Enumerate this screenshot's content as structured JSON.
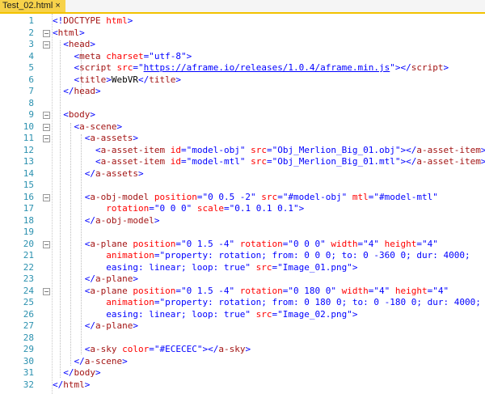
{
  "tab": {
    "title": "Test_02.html",
    "close_glyph": "×"
  },
  "fold_glyph": "⊟",
  "colors": {
    "bracket": "#0000ff",
    "tag": "#a31515",
    "attr": "#ff0000",
    "value": "#0000ff",
    "text": "#000000",
    "line_number": "#2b91af",
    "tab_accent": "#f2c200"
  },
  "lines": [
    {
      "n": "1",
      "tokens": [
        [
          "b",
          "<!"
        ],
        [
          "g",
          "DOCTYPE"
        ],
        [
          "a",
          " html"
        ],
        [
          "b",
          ">"
        ]
      ]
    },
    {
      "n": "2",
      "fold": true,
      "tokens": [
        [
          "b",
          "<"
        ],
        [
          "g",
          "html"
        ],
        [
          "b",
          ">"
        ]
      ]
    },
    {
      "n": "3",
      "fold": true,
      "tokens": [
        [
          "b",
          "  <"
        ],
        [
          "g",
          "head"
        ],
        [
          "b",
          ">"
        ]
      ]
    },
    {
      "n": "4",
      "tokens": [
        [
          "b",
          "    <"
        ],
        [
          "g",
          "meta"
        ],
        [
          "a",
          " charset"
        ],
        [
          "b",
          "="
        ],
        [
          "v",
          "\"utf-8\""
        ],
        [
          "b",
          ">"
        ]
      ]
    },
    {
      "n": "5",
      "tokens": [
        [
          "b",
          "    <"
        ],
        [
          "g",
          "script"
        ],
        [
          "a",
          " src"
        ],
        [
          "b",
          "=\""
        ],
        [
          "l",
          "https://aframe.io/releases/1.0.4/aframe.min.js"
        ],
        [
          "b",
          "\"></"
        ],
        [
          "g",
          "script"
        ],
        [
          "b",
          ">"
        ]
      ]
    },
    {
      "n": "6",
      "tokens": [
        [
          "b",
          "    <"
        ],
        [
          "g",
          "title"
        ],
        [
          "b",
          ">"
        ],
        [
          "t",
          "WebVR"
        ],
        [
          "b",
          "</"
        ],
        [
          "g",
          "title"
        ],
        [
          "b",
          ">"
        ]
      ]
    },
    {
      "n": "7",
      "tokens": [
        [
          "b",
          "  </"
        ],
        [
          "g",
          "head"
        ],
        [
          "b",
          ">"
        ]
      ]
    },
    {
      "n": "8",
      "tokens": []
    },
    {
      "n": "9",
      "fold": true,
      "tokens": [
        [
          "b",
          "  <"
        ],
        [
          "g",
          "body"
        ],
        [
          "b",
          ">"
        ]
      ]
    },
    {
      "n": "10",
      "fold": true,
      "tokens": [
        [
          "b",
          "    <"
        ],
        [
          "g",
          "a-scene"
        ],
        [
          "b",
          ">"
        ]
      ]
    },
    {
      "n": "11",
      "fold": true,
      "tokens": [
        [
          "b",
          "      <"
        ],
        [
          "g",
          "a-assets"
        ],
        [
          "b",
          ">"
        ]
      ]
    },
    {
      "n": "12",
      "tokens": [
        [
          "b",
          "        <"
        ],
        [
          "g",
          "a-asset-item"
        ],
        [
          "a",
          " id"
        ],
        [
          "b",
          "="
        ],
        [
          "v",
          "\"model-obj\""
        ],
        [
          "a",
          " src"
        ],
        [
          "b",
          "="
        ],
        [
          "v",
          "\"Obj_Merlion_Big_01.obj\""
        ],
        [
          "b",
          "></"
        ],
        [
          "g",
          "a-asset-item"
        ],
        [
          "b",
          ">"
        ]
      ]
    },
    {
      "n": "13",
      "tokens": [
        [
          "b",
          "        <"
        ],
        [
          "g",
          "a-asset-item"
        ],
        [
          "a",
          " id"
        ],
        [
          "b",
          "="
        ],
        [
          "v",
          "\"model-mtl\""
        ],
        [
          "a",
          " src"
        ],
        [
          "b",
          "="
        ],
        [
          "v",
          "\"Obj_Merlion_Big_01.mtl\""
        ],
        [
          "b",
          "></"
        ],
        [
          "g",
          "a-asset-item"
        ],
        [
          "b",
          ">"
        ]
      ]
    },
    {
      "n": "14",
      "tokens": [
        [
          "b",
          "      </"
        ],
        [
          "g",
          "a-assets"
        ],
        [
          "b",
          ">"
        ]
      ]
    },
    {
      "n": "15",
      "tokens": []
    },
    {
      "n": "16",
      "fold": true,
      "tokens": [
        [
          "b",
          "      <"
        ],
        [
          "g",
          "a-obj-model"
        ],
        [
          "a",
          " position"
        ],
        [
          "b",
          "="
        ],
        [
          "v",
          "\"0 0.5 -2\""
        ],
        [
          "a",
          " src"
        ],
        [
          "b",
          "="
        ],
        [
          "v",
          "\"#model-obj\""
        ],
        [
          "a",
          " mtl"
        ],
        [
          "b",
          "="
        ],
        [
          "v",
          "\"#model-mtl\""
        ]
      ]
    },
    {
      "n": "17",
      "tokens": [
        [
          "a",
          "          rotation"
        ],
        [
          "b",
          "="
        ],
        [
          "v",
          "\"0 0 0\""
        ],
        [
          "a",
          " scale"
        ],
        [
          "b",
          "="
        ],
        [
          "v",
          "\"0.1 0.1 0.1\""
        ],
        [
          "b",
          ">"
        ]
      ]
    },
    {
      "n": "18",
      "tokens": [
        [
          "b",
          "      </"
        ],
        [
          "g",
          "a-obj-model"
        ],
        [
          "b",
          ">"
        ]
      ]
    },
    {
      "n": "19",
      "tokens": []
    },
    {
      "n": "20",
      "fold": true,
      "tokens": [
        [
          "b",
          "      <"
        ],
        [
          "g",
          "a-plane"
        ],
        [
          "a",
          " position"
        ],
        [
          "b",
          "="
        ],
        [
          "v",
          "\"0 1.5 -4\""
        ],
        [
          "a",
          " rotation"
        ],
        [
          "b",
          "="
        ],
        [
          "v",
          "\"0 0 0\""
        ],
        [
          "a",
          " width"
        ],
        [
          "b",
          "="
        ],
        [
          "v",
          "\"4\""
        ],
        [
          "a",
          " height"
        ],
        [
          "b",
          "="
        ],
        [
          "v",
          "\"4\""
        ]
      ]
    },
    {
      "n": "21",
      "tokens": [
        [
          "a",
          "          animation"
        ],
        [
          "b",
          "="
        ],
        [
          "v",
          "\"property: rotation; from: 0 0 0; to: 0 -360 0; dur: 4000;"
        ]
      ]
    },
    {
      "n": "22",
      "tokens": [
        [
          "v",
          "          easing: linear; loop: true\""
        ],
        [
          "a",
          " src"
        ],
        [
          "b",
          "="
        ],
        [
          "v",
          "\"Image_01.png\""
        ],
        [
          "b",
          ">"
        ]
      ]
    },
    {
      "n": "23",
      "tokens": [
        [
          "b",
          "      </"
        ],
        [
          "g",
          "a-plane"
        ],
        [
          "b",
          ">"
        ]
      ]
    },
    {
      "n": "24",
      "fold": true,
      "tokens": [
        [
          "b",
          "      <"
        ],
        [
          "g",
          "a-plane"
        ],
        [
          "a",
          " position"
        ],
        [
          "b",
          "="
        ],
        [
          "v",
          "\"0 1.5 -4\""
        ],
        [
          "a",
          " rotation"
        ],
        [
          "b",
          "="
        ],
        [
          "v",
          "\"0 180 0\""
        ],
        [
          "a",
          " width"
        ],
        [
          "b",
          "="
        ],
        [
          "v",
          "\"4\""
        ],
        [
          "a",
          " height"
        ],
        [
          "b",
          "="
        ],
        [
          "v",
          "\"4\""
        ]
      ]
    },
    {
      "n": "25",
      "tokens": [
        [
          "a",
          "          animation"
        ],
        [
          "b",
          "="
        ],
        [
          "v",
          "\"property: rotation; from: 0 180 0; to: 0 -180 0; dur: 4000;"
        ]
      ]
    },
    {
      "n": "26",
      "tokens": [
        [
          "v",
          "          easing: linear; loop: true\""
        ],
        [
          "a",
          " src"
        ],
        [
          "b",
          "="
        ],
        [
          "v",
          "\"Image_02.png\""
        ],
        [
          "b",
          ">"
        ]
      ]
    },
    {
      "n": "27",
      "tokens": [
        [
          "b",
          "      </"
        ],
        [
          "g",
          "a-plane"
        ],
        [
          "b",
          ">"
        ]
      ]
    },
    {
      "n": "28",
      "tokens": []
    },
    {
      "n": "29",
      "tokens": [
        [
          "b",
          "      <"
        ],
        [
          "g",
          "a-sky"
        ],
        [
          "a",
          " color"
        ],
        [
          "b",
          "="
        ],
        [
          "v",
          "\"#ECECEC\""
        ],
        [
          "b",
          "></"
        ],
        [
          "g",
          "a-sky"
        ],
        [
          "b",
          ">"
        ]
      ]
    },
    {
      "n": "30",
      "tokens": [
        [
          "b",
          "    </"
        ],
        [
          "g",
          "a-scene"
        ],
        [
          "b",
          ">"
        ]
      ]
    },
    {
      "n": "31",
      "tokens": [
        [
          "b",
          "  </"
        ],
        [
          "g",
          "body"
        ],
        [
          "b",
          ">"
        ]
      ]
    },
    {
      "n": "32",
      "tokens": [
        [
          "b",
          "</"
        ],
        [
          "g",
          "html"
        ],
        [
          "b",
          ">"
        ]
      ]
    }
  ]
}
